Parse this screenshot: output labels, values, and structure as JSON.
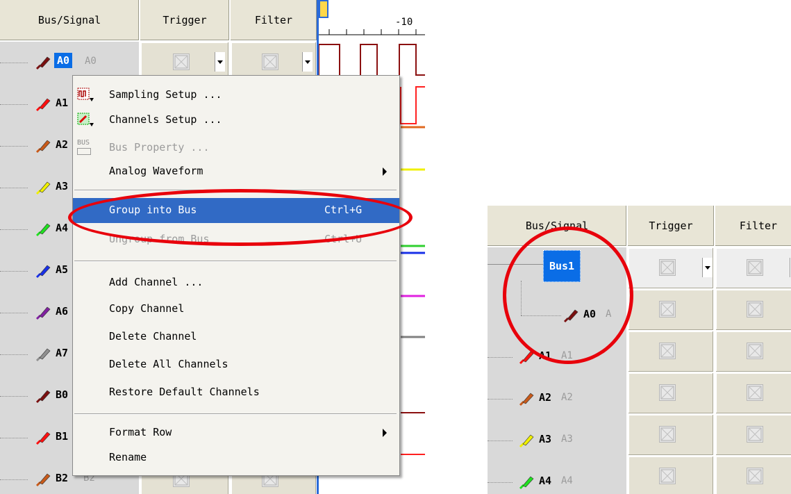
{
  "headers": {
    "bus_signal": "Bus/Signal",
    "trigger": "Trigger",
    "filter": "Filter"
  },
  "ruler_label": "-10",
  "left_signals": [
    {
      "name": "A0",
      "alias": "A0",
      "color": "#7a1010"
    },
    {
      "name": "A1",
      "alias": "",
      "color": "#ff1010"
    },
    {
      "name": "A2",
      "alias": "",
      "color": "#c85a1a"
    },
    {
      "name": "A3",
      "alias": "",
      "color": "#f0f000"
    },
    {
      "name": "A4",
      "alias": "",
      "color": "#20e020"
    },
    {
      "name": "A5",
      "alias": "",
      "color": "#1830e8"
    },
    {
      "name": "A6",
      "alias": "",
      "color": "#8020a0"
    },
    {
      "name": "A7",
      "alias": "",
      "color": "#909090"
    },
    {
      "name": "B0",
      "alias": "",
      "color": "#7a1010"
    },
    {
      "name": "B1",
      "alias": "",
      "color": "#ff1010"
    },
    {
      "name": "B2",
      "alias": "B2",
      "color": "#c85a1a"
    }
  ],
  "menu": {
    "sampling_setup": "Sampling Setup ...",
    "channels_setup": "Channels Setup ...",
    "bus_property": "Bus Property ...",
    "bus_icon_text": "BUS",
    "analog_waveform": "Analog Waveform",
    "group_into_bus": "Group into Bus",
    "group_shortcut": "Ctrl+G",
    "ungroup_from_bus": "Ungroup from Bus",
    "ungroup_shortcut": "Ctrl+U",
    "add_channel": "Add Channel ...",
    "copy_channel": "Copy Channel",
    "delete_channel": "Delete Channel",
    "delete_all_channels": "Delete All Channels",
    "restore_default_channels": "Restore Default Channels",
    "format_row": "Format Row",
    "rename": "Rename"
  },
  "right_panel": {
    "bus_name": "Bus1",
    "signals": [
      {
        "name": "A0",
        "alias": "A",
        "color": "#7a1010"
      },
      {
        "name": "A1",
        "alias": "A1",
        "color": "#ff1010"
      },
      {
        "name": "A2",
        "alias": "A2",
        "color": "#c85a1a"
      },
      {
        "name": "A3",
        "alias": "A3",
        "color": "#f0f000"
      },
      {
        "name": "A4",
        "alias": "A4",
        "color": "#20e020"
      }
    ]
  },
  "colors": {
    "selection": "#316ac5",
    "highlight_ring": "#e8000b",
    "panel_bg": "#d9d9d9",
    "header_bg": "#e8e5d6"
  }
}
